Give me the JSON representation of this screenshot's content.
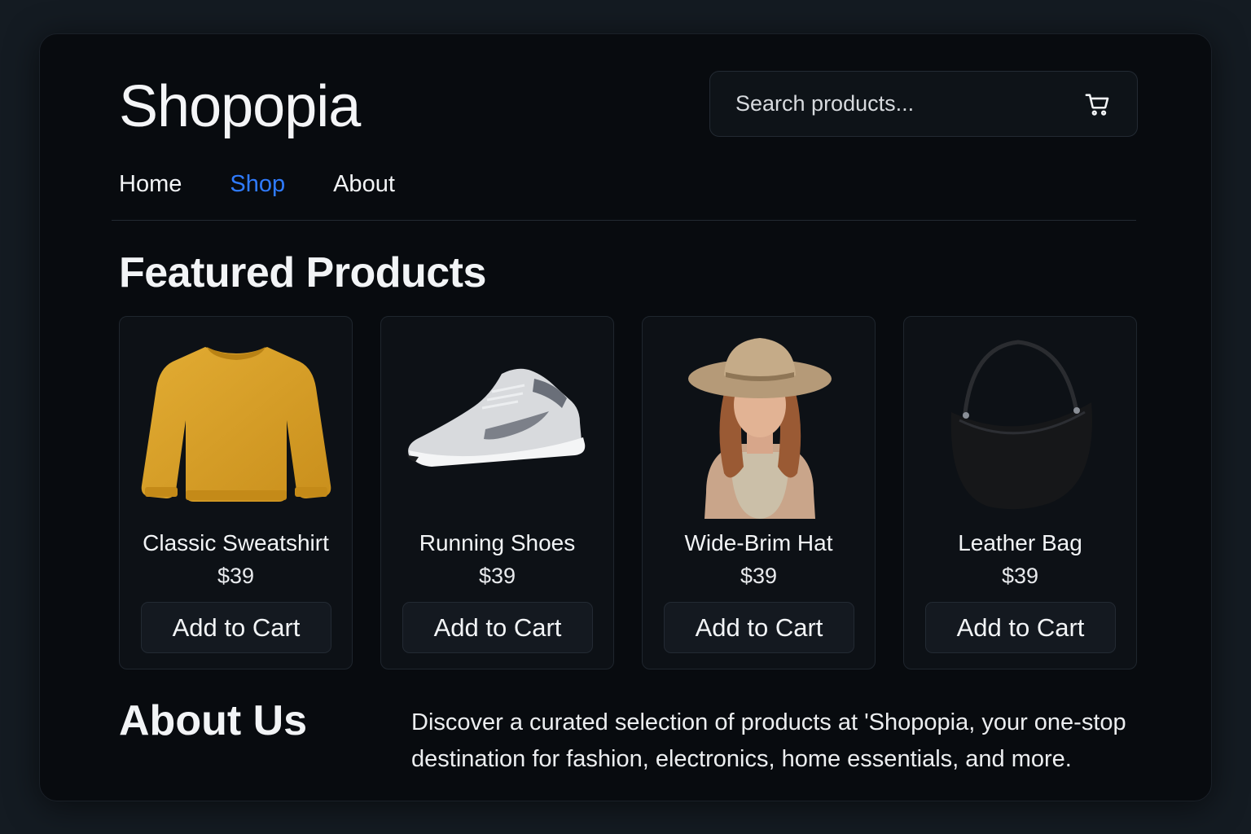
{
  "brand": {
    "name": "Shopopia"
  },
  "search": {
    "placeholder": "Search products..."
  },
  "nav": {
    "items": [
      {
        "label": "Home",
        "active": false
      },
      {
        "label": "Shop",
        "active": true
      },
      {
        "label": "About",
        "active": false
      }
    ]
  },
  "featured": {
    "title": "Featured Products",
    "products": [
      {
        "name": "Classic Sweatshirt",
        "price": "$39",
        "button": "Add to Cart",
        "image_icon": "sweatshirt-icon"
      },
      {
        "name": "Running Shoes",
        "price": "$39",
        "button": "Add to Cart",
        "image_icon": "sneaker-icon"
      },
      {
        "name": "Wide-Brim Hat",
        "price": "$39",
        "button": "Add to Cart",
        "image_icon": "hat-model-icon"
      },
      {
        "name": "Leather Bag",
        "price": "$39",
        "button": "Add to Cart",
        "image_icon": "handbag-icon"
      }
    ]
  },
  "about": {
    "title": "About Us",
    "text": "Discover a curated selection of products at 'Shopopia, your one-stop destination for fashion, electronics, home essentials, and more."
  },
  "colors": {
    "background": "#141b22",
    "panel": "#080b0f",
    "accent": "#2f7bff",
    "text": "#f2f4f6"
  }
}
